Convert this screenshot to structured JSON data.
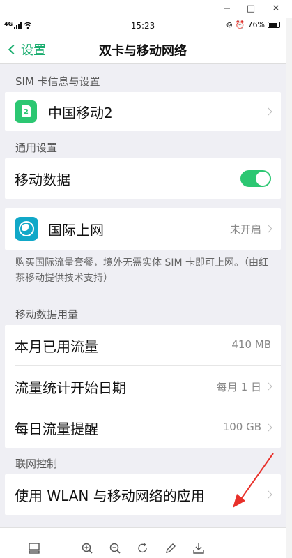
{
  "window": {
    "minimize": "−",
    "maximize": "□",
    "close": "✕"
  },
  "status_bar": {
    "network": "4G",
    "time": "15:23",
    "battery": "76%"
  },
  "nav": {
    "back_label": "设置",
    "title": "双卡与移动网络"
  },
  "sim_section": {
    "header": "SIM 卡信息与设置",
    "sim_name": "中国移动2",
    "sim_number": "2"
  },
  "general_section": {
    "header": "通用设置",
    "mobile_data_label": "移动数据",
    "mobile_data_on": true
  },
  "intl": {
    "label": "国际上网",
    "value": "未开启",
    "note": "购买国际流量套餐，境外无需实体 SIM 卡即可上网。（由红茶移动提供技术支持）"
  },
  "usage_section": {
    "header": "移动数据用量",
    "rows": [
      {
        "label": "本月已用流量",
        "value": "410 MB"
      },
      {
        "label": "流量统计开始日期",
        "value": "每月 1 日"
      },
      {
        "label": "每日流量提醒",
        "value": "100 GB"
      }
    ]
  },
  "network_control": {
    "header": "联网控制",
    "app_label": "使用 WLAN 与移动网络的应用"
  },
  "accent_color": "#2cc772",
  "toolbar_icons": [
    "layout-icon",
    "zoom-in-icon",
    "zoom-out-icon",
    "rotate-icon",
    "edit-icon",
    "download-icon"
  ]
}
